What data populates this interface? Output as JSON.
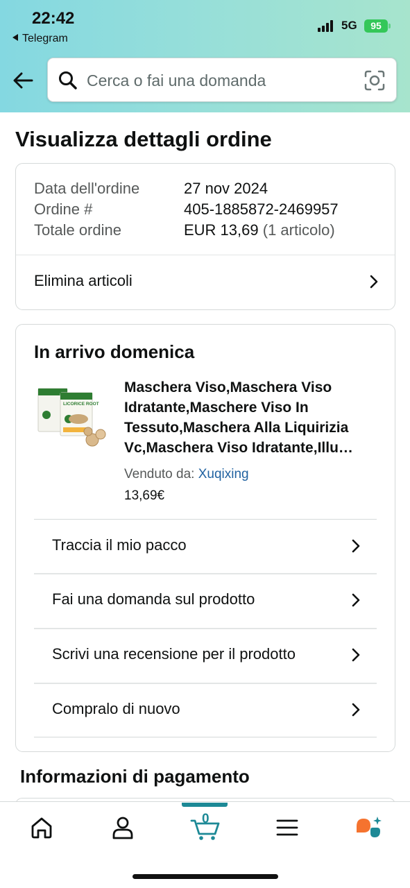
{
  "status_bar": {
    "time": "22:42",
    "back_app": "Telegram",
    "network": "5G",
    "battery": "95"
  },
  "search": {
    "placeholder": "Cerca o fai una domanda"
  },
  "page_title": "Visualizza dettagli ordine",
  "order_summary": {
    "rows": [
      {
        "label": "Data dell'ordine",
        "value": "27 nov 2024",
        "extra": ""
      },
      {
        "label": "Ordine #",
        "value": "405-1885872-2469957",
        "extra": ""
      },
      {
        "label": "Totale ordine",
        "value": "EUR 13,69",
        "extra": "(1 articolo)"
      }
    ],
    "action": "Elimina articoli"
  },
  "shipment": {
    "title": "In arrivo domenica",
    "product": {
      "title": "Maschera Viso,Maschera Viso Idratante,Maschere Viso In Tessuto,Maschera Alla Liquirizia Vc,Maschera Viso Idratante,Illu…",
      "image_text": "LICORICE ROOT",
      "sold_by_label": "Venduto da:",
      "seller": "Xuqixing",
      "price": "13,69€"
    },
    "actions": [
      "Traccia il mio pacco",
      "Fai una domanda sul prodotto",
      "Scrivi una recensione per il prodotto",
      "Compralo di nuovo"
    ]
  },
  "payment_title": "Informazioni di pagamento",
  "bottom_nav": {
    "cart_count": "0",
    "icons": [
      "home-icon",
      "account-icon",
      "cart-icon",
      "menu-icon",
      "rufus-icon"
    ]
  },
  "colors": {
    "header_gradient_start": "#84d8e1",
    "header_gradient_end": "#a7e4cd",
    "link": "#2162a1",
    "cart_accent": "#1d8996",
    "battery": "#34c759"
  }
}
